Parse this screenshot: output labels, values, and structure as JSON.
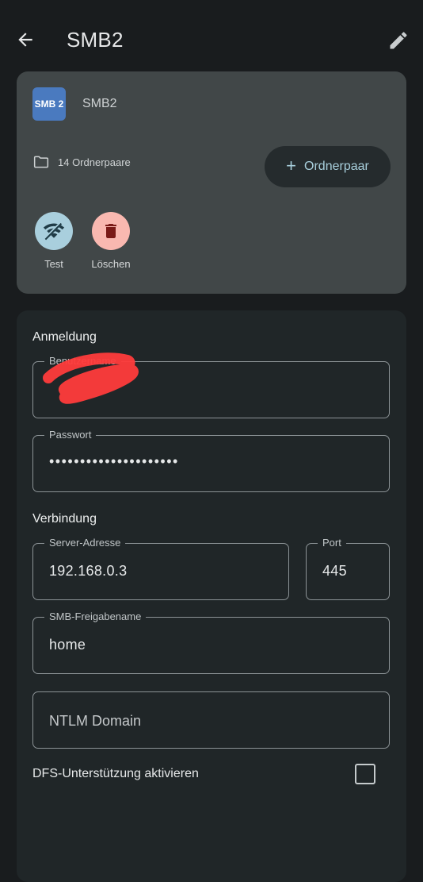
{
  "header": {
    "title": "SMB2",
    "back_icon": "arrow-left-icon",
    "edit_icon": "pencil-icon"
  },
  "summary": {
    "badge": "SMB 2",
    "name": "SMB2",
    "folder_pairs": "14 Ordnerpaare",
    "add_button": "Ordnerpaar",
    "actions": {
      "test": "Test",
      "delete": "Löschen"
    },
    "colors": {
      "badge": "#4a7abf",
      "test": "#a9cfdd",
      "delete": "#f9b8b0"
    }
  },
  "form": {
    "login_section": "Anmeldung",
    "username": {
      "label": "Benutzername",
      "value": ""
    },
    "password": {
      "label": "Passwort",
      "value": "•••••••••••••••••••••"
    },
    "connection_section": "Verbindung",
    "server": {
      "label": "Server-Adresse",
      "value": "192.168.0.3"
    },
    "port": {
      "label": "Port",
      "value": "445"
    },
    "share": {
      "label": "SMB-Freigabename",
      "value": "home"
    },
    "ntlm": {
      "placeholder": "NTLM Domain"
    },
    "dfs": {
      "label": "DFS-Unterstützung aktivieren",
      "checked": false
    }
  }
}
